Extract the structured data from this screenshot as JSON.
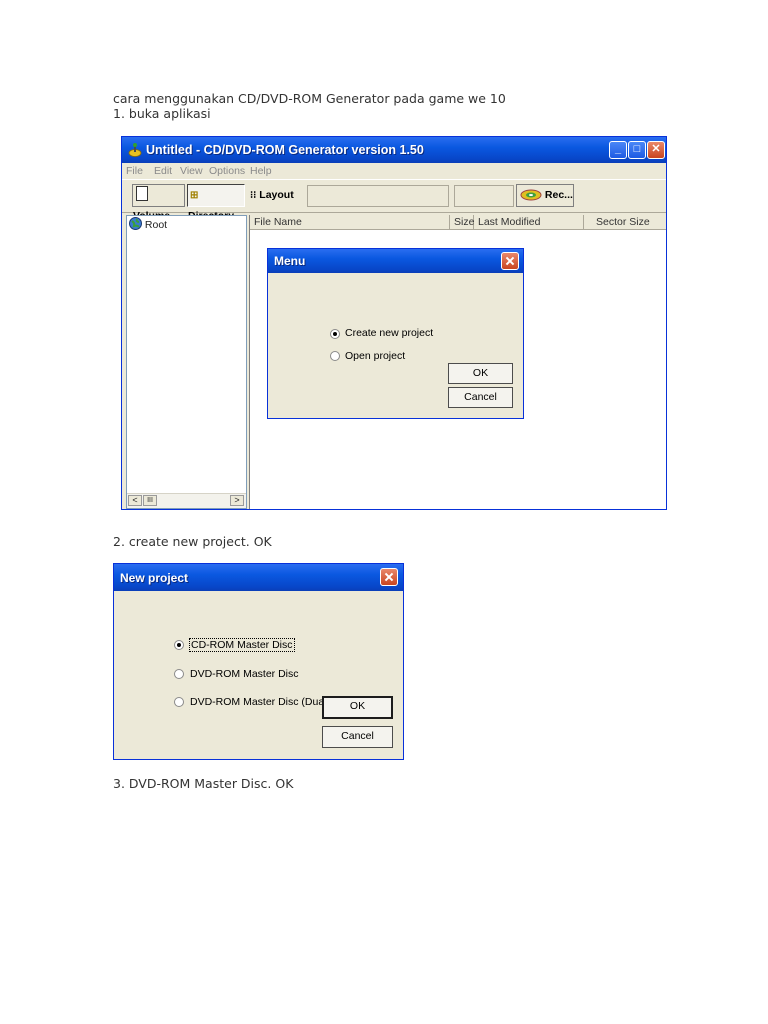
{
  "doc": {
    "heading": "cara menggunakan CD/DVD-ROM Generator pada game we 10",
    "step1": "1. buka aplikasi",
    "step2": "2. create new project. OK",
    "step3": "3. DVD-ROM Master Disc. OK"
  },
  "main_window": {
    "title": "Untitled - CD/DVD-ROM Generator version 1.50",
    "menu": [
      "File",
      "Edit",
      "View",
      "Options",
      "Help"
    ],
    "toolbar": {
      "volume": "Volume",
      "directory": "Directory",
      "layout": "Layout",
      "record": "Rec..."
    },
    "tree_root": "Root",
    "columns": [
      "File Name",
      "Size",
      "Last Modified",
      "Sector Size"
    ],
    "scroll_thumb": "III"
  },
  "menu_dialog": {
    "title": "Menu",
    "options": [
      "Create new project",
      "Open project"
    ],
    "selected": 0,
    "ok": "OK",
    "cancel": "Cancel"
  },
  "new_project_dialog": {
    "title": "New project",
    "options": [
      "CD-ROM Master Disc",
      "DVD-ROM Master Disc",
      "DVD-ROM Master Disc (Dua"
    ],
    "selected": 0,
    "ok": "OK",
    "cancel": "Cancel"
  },
  "colors": {
    "titlebar": "#0a58e0",
    "window_bg": "#ece9d8",
    "close_button": "#c9451f"
  },
  "icons": [
    "app-icon",
    "minimize-icon",
    "maximize-icon",
    "close-icon",
    "volume-icon",
    "directory-icon",
    "layout-icon",
    "record-disc-icon",
    "globe-icon"
  ]
}
